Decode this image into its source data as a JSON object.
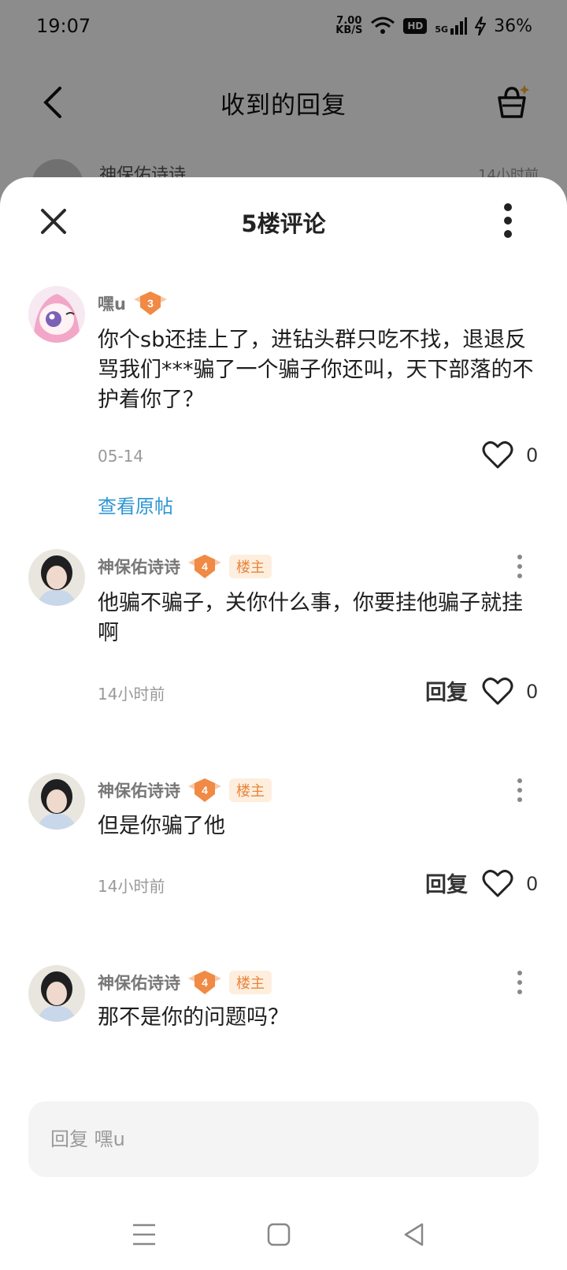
{
  "status_bar": {
    "time": "19:07",
    "net_speed": "7.00",
    "net_unit": "KB/S",
    "hd": "HD",
    "signal": "5G",
    "battery": "36%"
  },
  "background_page": {
    "title": "收到的回复",
    "row_name": "神保佑诗诗",
    "row_time": "14小时前"
  },
  "sheet": {
    "title": "5楼评论",
    "main_comment": {
      "user": "嘿u",
      "level": "3",
      "text": "你个sb还挂上了，进钻头群只吃不找，退退反骂我们***骗了一个骗子你还叫，天下部落的不护着你了？",
      "date": "05-14",
      "likes": "0",
      "view_original": "查看原帖"
    },
    "replies": [
      {
        "user": "神保佑诗诗",
        "level": "4",
        "tag": "楼主",
        "text": "他骗不骗子，关你什么事，你要挂他骗子就挂啊",
        "time": "14小时前",
        "reply_label": "回复",
        "likes": "0"
      },
      {
        "user": "神保佑诗诗",
        "level": "4",
        "tag": "楼主",
        "text": "但是你骗了他",
        "time": "14小时前",
        "reply_label": "回复",
        "likes": "0"
      },
      {
        "user": "神保佑诗诗",
        "level": "4",
        "tag": "楼主",
        "text": "那不是你的问题吗？"
      }
    ],
    "reply_input_placeholder": "回复 嘿u"
  },
  "colors": {
    "accent_link": "#2f97d4",
    "level_badge": "#f08a45",
    "owner_tag_bg": "#fdeedd",
    "owner_tag_text": "#e8843b"
  },
  "icons": [
    "back-icon",
    "basket-icon",
    "close-icon",
    "more-icon",
    "heart-icon",
    "menu-icon",
    "home-icon",
    "back-triangle-icon"
  ]
}
